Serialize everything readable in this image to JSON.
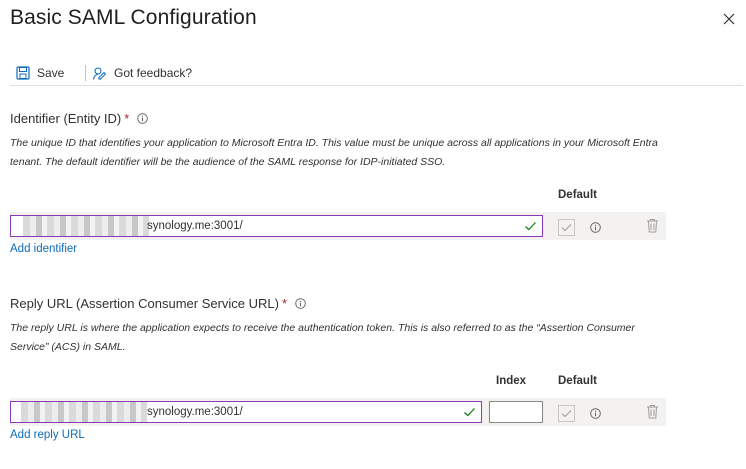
{
  "header": {
    "title": "Basic SAML Configuration"
  },
  "toolbar": {
    "save_label": "Save",
    "feedback_label": "Got feedback?"
  },
  "identifier": {
    "label": "Identifier (Entity ID)",
    "required_mark": "*",
    "description": "The unique ID that identifies your application to Microsoft Entra ID. This value must be unique across all applications in your Microsoft Entra tenant. The default identifier will be the audience of the SAML response for IDP-initiated SSO.",
    "default_header": "Default",
    "value_suffix": "synology.me:3001/",
    "add_link": "Add identifier"
  },
  "reply": {
    "label": "Reply URL (Assertion Consumer Service URL)",
    "required_mark": "*",
    "description": "The reply URL is where the application expects to receive the authentication token. This is also referred to as the “Assertion Consumer Service” (ACS) in SAML.",
    "index_header": "Index",
    "default_header": "Default",
    "value_suffix": "synology.me:3001/",
    "index_value": "",
    "add_link": "Add reply URL"
  },
  "colors": {
    "accent": "#0f6cbd",
    "input_border": "#8a3bb3",
    "required": "#a4262c",
    "valid": "#107c10"
  },
  "icons": [
    "save-icon",
    "feedback-icon",
    "close-icon",
    "info-icon",
    "checkmark-icon",
    "trash-icon"
  ]
}
